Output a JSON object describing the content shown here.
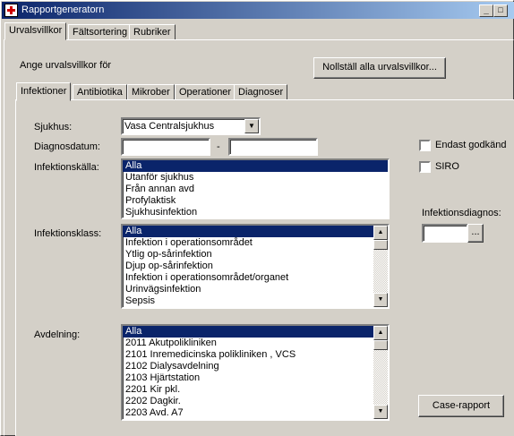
{
  "window": {
    "title": "Rapportgeneratorn",
    "min": "_",
    "max": "□",
    "close": "×"
  },
  "top_tabs": [
    "Urvalsvillkor",
    "Fältsortering",
    "Rubriker"
  ],
  "prompt_label": "Ange urvalsvillkor för",
  "reset_button": "Nollställ alla urvalsvillkor...",
  "sub_tabs": [
    "Infektioner",
    "Antibiotika",
    "Mikrober",
    "Operationer",
    "Diagnoser"
  ],
  "form": {
    "sjukhus_label": "Sjukhus:",
    "sjukhus_value": "Vasa Centralsjukhus",
    "datum_label": "Diagnosdatum:",
    "datum_from": "",
    "datum_sep": "-",
    "datum_to": "",
    "kalla_label": "Infektionskälla:",
    "kalla_items": [
      "Alla",
      "Utanför sjukhus",
      "Från annan avd",
      "Profylaktisk",
      "Sjukhusinfektion"
    ],
    "klass_label": "Infektionsklass:",
    "klass_items": [
      "Alla",
      "Infektion i operationsområdet",
      "Ytlig op-sårinfektion",
      "Djup op-sårinfektion",
      "Infektion i operationsområdet/organet",
      "Urinvägsinfektion",
      "Sepsis"
    ],
    "avd_label": "Avdelning:",
    "avd_items": [
      "Alla",
      "2011 Akutpolikliniken",
      "2101 Inremedicinska polikliniken , VCS",
      "2102 Dialysavdelning",
      "2103 Hjärtstation",
      "2201 Kir pkl.",
      "2202 Dagkir.",
      "2203 Avd. A7"
    ],
    "endast_label": "Endast godkänd",
    "siro_label": "SIRO",
    "diagnos_label": "Infektionsdiagnos:",
    "diagnos_value": "",
    "browse_label": "...",
    "case_button": "Case-rapport"
  }
}
